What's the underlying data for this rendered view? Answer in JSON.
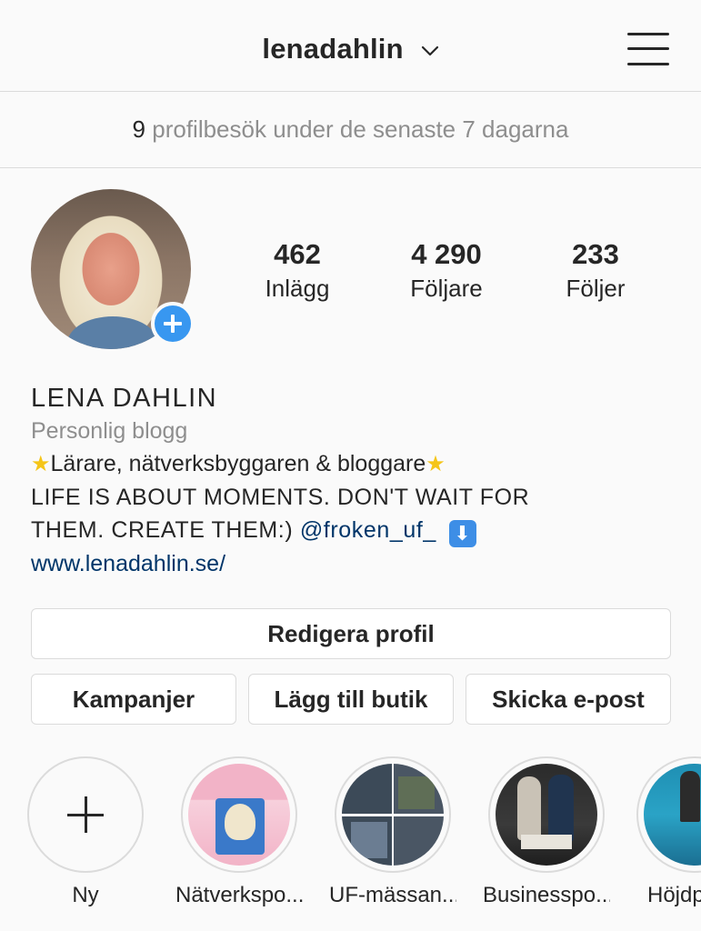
{
  "header": {
    "username": "lenadahlin"
  },
  "insights": {
    "count": "9",
    "text": "profilbesök under de senaste 7 dagarna"
  },
  "stats": [
    {
      "value": "462",
      "label": "Inlägg"
    },
    {
      "value": "4 290",
      "label": "Följare"
    },
    {
      "value": "233",
      "label": "Följer"
    }
  ],
  "profile": {
    "name": "LENA DAHLIN",
    "category": "Personlig blogg",
    "bio_line1": "Lärare, nätverksbyggaren & bloggare",
    "bio_line2": "LIFE IS ABOUT MOMENTS. DON'T WAIT FOR",
    "bio_line3_prefix": "THEM. CREATE THEM:)",
    "bio_mention": "@froken_uf_",
    "website": "www.lenadahlin.se/"
  },
  "buttons": {
    "edit_profile": "Redigera profil",
    "promotions": "Kampanjer",
    "add_shop": "Lägg till butik",
    "email": "Skicka e-post"
  },
  "highlights": [
    {
      "label": "Ny"
    },
    {
      "label": "Nätverkspo..."
    },
    {
      "label": "UF-mässan..."
    },
    {
      "label": "Businesspo..."
    },
    {
      "label": "Höjdpu"
    }
  ],
  "colors": {
    "accent": "#3897f0",
    "link": "#003569",
    "text": "#262626",
    "muted": "#8e8e8e",
    "border": "#dbdbdb"
  },
  "icons": {
    "menu": "hamburger-icon",
    "username_dropdown": "chevron-down-icon",
    "add_story": "plus-icon",
    "bio_star": "star-icon",
    "bio_arrow": "down-arrow-icon"
  }
}
